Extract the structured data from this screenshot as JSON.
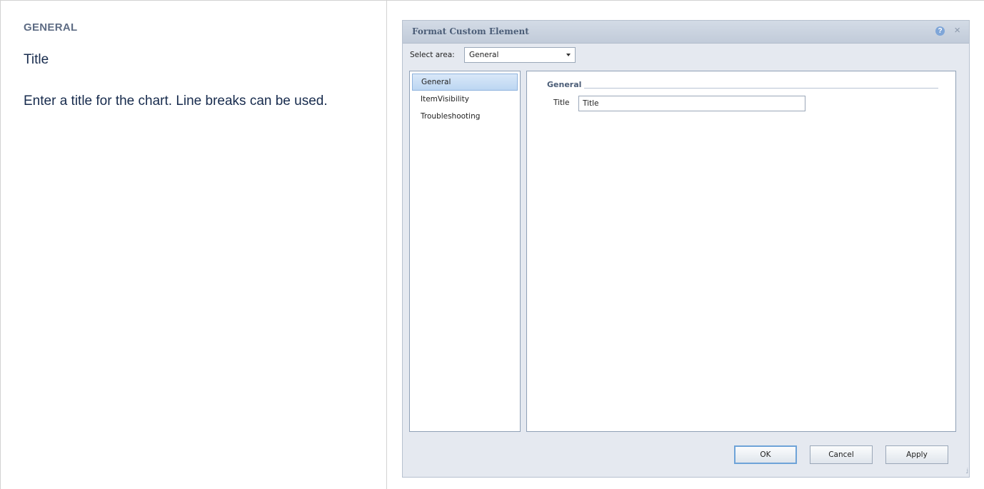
{
  "doc": {
    "section_heading": "GENERAL",
    "title": "Title",
    "description": "Enter a title for the chart. Line breaks can be used."
  },
  "dialog": {
    "title": "Format Custom Element",
    "help_icon": "?",
    "close_icon": "×",
    "select_label": "Select area:",
    "select_value": "General",
    "nav_items": [
      {
        "label": "General",
        "selected": true
      },
      {
        "label": "ItemVisibility",
        "selected": false
      },
      {
        "label": "Troubleshooting",
        "selected": false
      }
    ],
    "group_title": "General",
    "field_label": "Title",
    "field_value": "Title",
    "buttons": {
      "ok": "OK",
      "cancel": "Cancel",
      "apply": "Apply"
    },
    "resize_grip": ".:i"
  }
}
